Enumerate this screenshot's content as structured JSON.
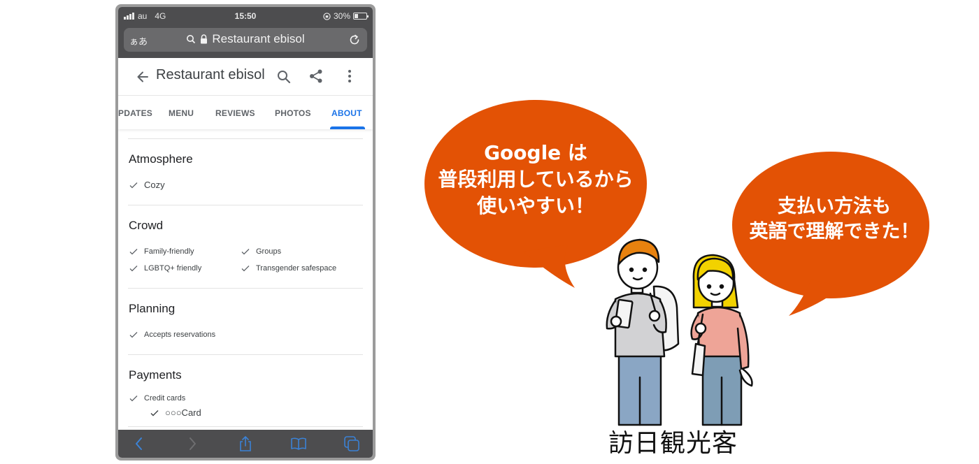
{
  "status_bar": {
    "carrier": "au",
    "network": "4G",
    "time": "15:50",
    "battery": "30%",
    "battery_level": 0.3
  },
  "url_bar": {
    "text_size_label": "ぁあ",
    "url": "Restaurant ebisol"
  },
  "app_bar": {
    "title": "Restaurant ebisol"
  },
  "tabs": [
    {
      "label": "UPDATES",
      "visible_label": "PDATES"
    },
    {
      "label": "MENU"
    },
    {
      "label": "REVIEWS"
    },
    {
      "label": "PHOTOS"
    },
    {
      "label": "ABOUT",
      "active": true
    }
  ],
  "sections": [
    {
      "title": "Atmosphere",
      "items": [
        "Cozy"
      ]
    },
    {
      "title": "Crowd",
      "items": [
        "Family-friendly",
        "Groups",
        "LGBTQ+ friendly",
        "Transgender safespace"
      ]
    },
    {
      "title": "Planning",
      "items": [
        "Accepts reservations"
      ]
    },
    {
      "title": "Payments",
      "items": [
        "Credit cards"
      ],
      "sub_items": [
        "○○○Card"
      ]
    }
  ],
  "bottom_bar": {
    "icons": [
      "back-icon",
      "forward-icon",
      "share-icon",
      "bookmarks-icon",
      "tabs-icon"
    ]
  },
  "illustration": {
    "bubble_1": {
      "line1": "Google は",
      "line2": "普段利用しているから",
      "line3": "使いやすい！"
    },
    "bubble_2": {
      "line1": "支払い方法も",
      "line2": "英語で理解できた！"
    },
    "caption": "訪日観光客",
    "colors": {
      "bubble": "#e35205",
      "hair_boy": "#e8820f",
      "hair_girl": "#f2d200",
      "shirt_boy": "#d2d2d4",
      "shirt_girl": "#eea497",
      "pants": "#8aa6c4"
    }
  },
  "colors": {
    "accent": "#1a73e8",
    "browser_chrome": "#4d4d4f",
    "ios_blue": "#3b82d6"
  }
}
